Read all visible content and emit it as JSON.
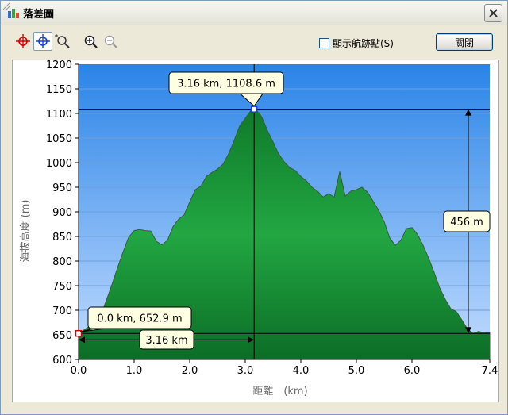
{
  "window": {
    "title": "落差圖"
  },
  "toolbar": {
    "checkbox_label": "顯示航跡點(S)",
    "checkbox_checked": false,
    "close_label": "關閉",
    "icons": [
      "crosshair-red-icon",
      "crosshair-blue-icon",
      "zoom-select-icon",
      "zoom-in-icon",
      "zoom-out-icon"
    ]
  },
  "colors": {
    "plot_top": "#3d8fe8",
    "plot_bottom": "#bcd6ff",
    "area_fill": "#1f9a3a",
    "area_edge": "#0b5a1c",
    "callout_bg": "#ffffe1"
  },
  "chart_data": {
    "type": "area",
    "title": "",
    "xlabel": "距離　(km)",
    "ylabel": "海拔高度 (m)",
    "xlim": [
      0,
      7.4
    ],
    "ylim": [
      600,
      1200
    ],
    "x_ticks": [
      "0.0",
      "1.0",
      "2.0",
      "3.0",
      "4.0",
      "5.0",
      "6.0",
      "7.4"
    ],
    "x_tick_values": [
      0,
      1,
      2,
      3,
      4,
      5,
      6,
      7.4
    ],
    "y_ticks": [
      "600",
      "650",
      "700",
      "750",
      "800",
      "850",
      "900",
      "950",
      "1000",
      "1050",
      "1100",
      "1150",
      "1200"
    ],
    "y_tick_values": [
      600,
      650,
      700,
      750,
      800,
      850,
      900,
      950,
      1000,
      1050,
      1100,
      1150,
      1200
    ],
    "grid": true,
    "series": [
      {
        "values": [
          [
            0,
            652.9
          ],
          [
            0.1,
            660
          ],
          [
            0.2,
            668
          ],
          [
            0.3,
            674
          ],
          [
            0.4,
            690
          ],
          [
            0.5,
            720
          ],
          [
            0.6,
            752
          ],
          [
            0.7,
            786
          ],
          [
            0.8,
            818
          ],
          [
            0.9,
            848
          ],
          [
            1.0,
            862
          ],
          [
            1.1,
            864
          ],
          [
            1.2,
            862
          ],
          [
            1.3,
            861
          ],
          [
            1.4,
            840
          ],
          [
            1.5,
            833
          ],
          [
            1.6,
            842
          ],
          [
            1.7,
            870
          ],
          [
            1.8,
            885
          ],
          [
            1.9,
            894
          ],
          [
            2.0,
            920
          ],
          [
            2.1,
            945
          ],
          [
            2.2,
            952
          ],
          [
            2.3,
            972
          ],
          [
            2.4,
            980
          ],
          [
            2.5,
            987
          ],
          [
            2.6,
            997
          ],
          [
            2.7,
            1018
          ],
          [
            2.8,
            1045
          ],
          [
            2.9,
            1075
          ],
          [
            3.0,
            1090
          ],
          [
            3.1,
            1106
          ],
          [
            3.16,
            1108.6
          ],
          [
            3.25,
            1101
          ],
          [
            3.3,
            1092
          ],
          [
            3.4,
            1065
          ],
          [
            3.5,
            1042
          ],
          [
            3.6,
            1018
          ],
          [
            3.7,
            1002
          ],
          [
            3.8,
            990
          ],
          [
            3.9,
            984
          ],
          [
            4.0,
            972
          ],
          [
            4.1,
            963
          ],
          [
            4.2,
            950
          ],
          [
            4.3,
            942
          ],
          [
            4.4,
            930
          ],
          [
            4.5,
            937
          ],
          [
            4.6,
            930
          ],
          [
            4.7,
            982
          ],
          [
            4.8,
            932
          ],
          [
            4.9,
            942
          ],
          [
            5.0,
            945
          ],
          [
            5.1,
            950
          ],
          [
            5.2,
            940
          ],
          [
            5.3,
            922
          ],
          [
            5.4,
            903
          ],
          [
            5.5,
            880
          ],
          [
            5.6,
            847
          ],
          [
            5.7,
            832
          ],
          [
            5.8,
            842
          ],
          [
            5.9,
            866
          ],
          [
            6.0,
            868
          ],
          [
            6.1,
            854
          ],
          [
            6.2,
            832
          ],
          [
            6.3,
            806
          ],
          [
            6.4,
            777
          ],
          [
            6.5,
            745
          ],
          [
            6.6,
            722
          ],
          [
            6.7,
            703
          ],
          [
            6.8,
            697
          ],
          [
            6.9,
            680
          ],
          [
            7.0,
            662
          ],
          [
            7.1,
            653
          ],
          [
            7.2,
            657
          ],
          [
            7.3,
            654
          ],
          [
            7.4,
            654
          ]
        ]
      }
    ],
    "annotations": {
      "peak_label": "3.16 km, 1108.6 m",
      "start_label": "0.0 km, 652.9 m",
      "distance_label": "3.16 km",
      "gain_label": "456 m",
      "peak_point": [
        3.16,
        1108.6
      ],
      "start_point": [
        0,
        652.9
      ]
    }
  }
}
